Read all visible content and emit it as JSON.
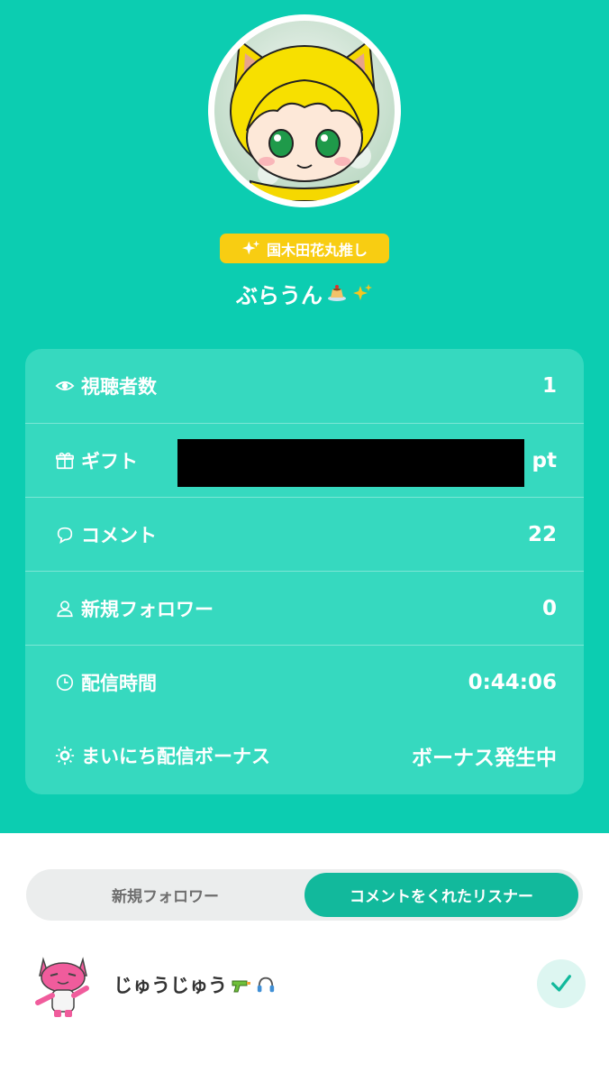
{
  "profile": {
    "badge_text": "国木田花丸推し",
    "badge_icon": "sparkle-icon",
    "username": "ぶらうん",
    "username_emojis": [
      "pudding-emoji",
      "sparkles-emoji"
    ]
  },
  "stats": [
    {
      "icon": "eye-icon",
      "label": "視聴者数",
      "value": "1"
    },
    {
      "icon": "gift-icon",
      "label": "ギフト",
      "value": "pt",
      "redacted": true
    },
    {
      "icon": "comment-icon",
      "label": "コメント",
      "value": "22"
    },
    {
      "icon": "person-icon",
      "label": "新規フォロワー",
      "value": "0"
    },
    {
      "icon": "clock-icon",
      "label": "配信時間",
      "value": "0:44:06"
    },
    {
      "icon": "bonus-sun-icon",
      "label": "まいにち配信ボーナス",
      "value": "ボーナス発生中"
    }
  ],
  "tabs": {
    "new_followers": "新規フォロワー",
    "commenters": "コメントをくれたリスナー",
    "active": "commenters"
  },
  "listeners": [
    {
      "name": "じゅうじゅう",
      "emojis": [
        "water-gun-emoji",
        "headphones-emoji"
      ],
      "checked": true
    }
  ],
  "colors": {
    "background_teal": "#0ccdb1",
    "card_teal": "#36d9bf",
    "badge_yellow": "#f8cd12",
    "active_tab": "#12b99c"
  }
}
